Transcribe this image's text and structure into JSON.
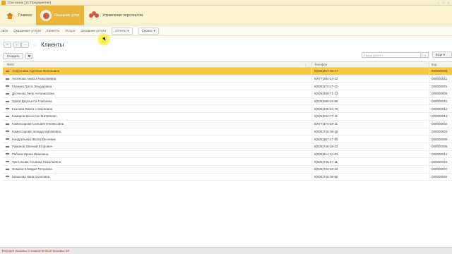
{
  "window": {
    "title": "Спа-салон (1С:Предприятие)"
  },
  "sections": [
    {
      "label": "Главное",
      "icon": "home-icon"
    },
    {
      "label": "Оказание услуг",
      "icon": "user-icon"
    },
    {
      "label": "Управление персоналом",
      "icon": "staff-icon"
    }
  ],
  "subnav": {
    "items": [
      "лиси",
      "Оказанные услуги",
      "Клиенты",
      "Услуги",
      "Оказание услуги"
    ],
    "reports": "Отчеты",
    "service": "Сервис"
  },
  "form": {
    "title": "Клиенты",
    "create_label": "Создать",
    "search_placeholder": "Поиск (Ctrl+F)",
    "search_clear": "×",
    "more_label": "Еще"
  },
  "grid": {
    "columns": {
      "fio": "ФИО",
      "phone": "Телефон",
      "code": "Код"
    },
    "rows": [
      {
        "fio": "Агафонова Аделина Филиповна",
        "phone": "8(926)457-36-27",
        "code": "000000005"
      },
      {
        "fio": "Аксёнова Анисья Николаевна",
        "phone": "8(977)394-24-22",
        "code": "000000011"
      },
      {
        "fio": "Галкина Грета Эльдаровна",
        "phone": "8(926)274-27-42",
        "code": "000000001"
      },
      {
        "fio": "Дьячкова Лилу Антониновна",
        "phone": "8(925)489-71-33",
        "code": "000000009"
      },
      {
        "fio": "Зуева Джульетта Глебовна",
        "phone": "8(926)689-29-55",
        "code": "000000010"
      },
      {
        "fio": "Козлова Янита Алексеевна",
        "phone": "8(926)338-40-79",
        "code": "000000012"
      },
      {
        "fio": "Комаров Валентин Матвеевич",
        "phone": "8(925)844-77-11",
        "code": "000000013"
      },
      {
        "fio": "Комиссарова Сильвия Феликсовна",
        "phone": "8(977)374-28-11",
        "code": "000000002"
      },
      {
        "fio": "Комиссарова Эллада Матвеевна",
        "phone": "8(926)746-38-28",
        "code": "000000003"
      },
      {
        "fio": "Кондратьева Жюли Евсеевна",
        "phone": "8(926)367-27-55",
        "code": "000000008"
      },
      {
        "fio": "Романов Евгений Егорович",
        "phone": "8(926)746-38-22",
        "code": "000000006"
      },
      {
        "fio": "Рябова Ирина Ивановна",
        "phone": "8(926)814-24-53",
        "code": "000000014"
      },
      {
        "fio": "Третьякова Альвина Николаевна",
        "phone": "8(926)746-27-11",
        "code": "000000015"
      },
      {
        "fio": "Фомина Клавдия Петровна",
        "phone": "8(926)723-33-22",
        "code": "000000007"
      },
      {
        "fio": "Шашкова Лана Осиповна",
        "phone": "8(926)746-38-90",
        "code": "000000004"
      }
    ]
  },
  "status": {
    "text": "Текущие вызовы: 0   Накопленные вызовы: 60"
  },
  "colors": {
    "accent": "#eab53c",
    "selected_row": "#f9c840",
    "status_text": "#c0392b"
  }
}
